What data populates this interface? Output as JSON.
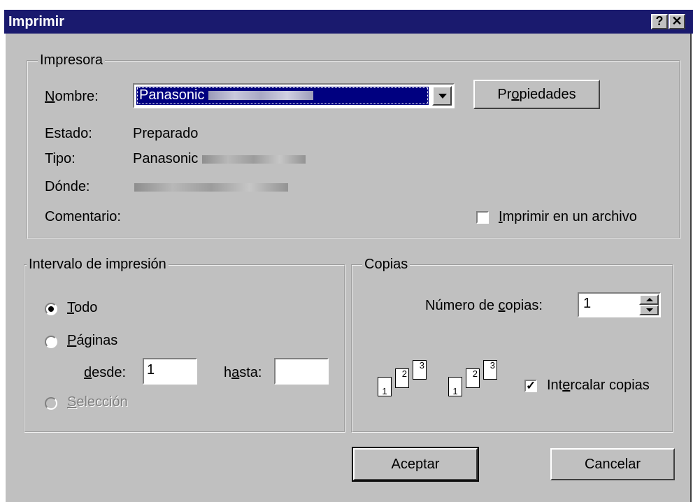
{
  "window": {
    "title": "Imprimir",
    "help_button": "?",
    "close_button": "✕"
  },
  "printer": {
    "group_label": "Impresora",
    "name_label": "Nombre:",
    "name_value": "Panasonic",
    "properties_button": "Propiedades",
    "status_label": "Estado:",
    "status_value": "Preparado",
    "type_label": "Tipo:",
    "type_value": "Panasonic",
    "where_label": "Dónde:",
    "comment_label": "Comentario:",
    "print_to_file_label": "Imprimir en un archivo",
    "print_to_file_checked": false
  },
  "range": {
    "group_label": "Intervalo de impresión",
    "all_label": "Todo",
    "pages_label": "Páginas",
    "from_label": "desde:",
    "from_value": "1",
    "to_label": "hasta:",
    "to_value": "",
    "selection_label": "Selección",
    "selected": "all"
  },
  "copies": {
    "group_label": "Copias",
    "count_label": "Número de copias:",
    "count_value": "1",
    "collate_label": "Intercalar copias",
    "collate_checked": true,
    "collate_pages": [
      "1",
      "2",
      "3"
    ]
  },
  "buttons": {
    "ok": "Aceptar",
    "cancel": "Cancelar"
  }
}
